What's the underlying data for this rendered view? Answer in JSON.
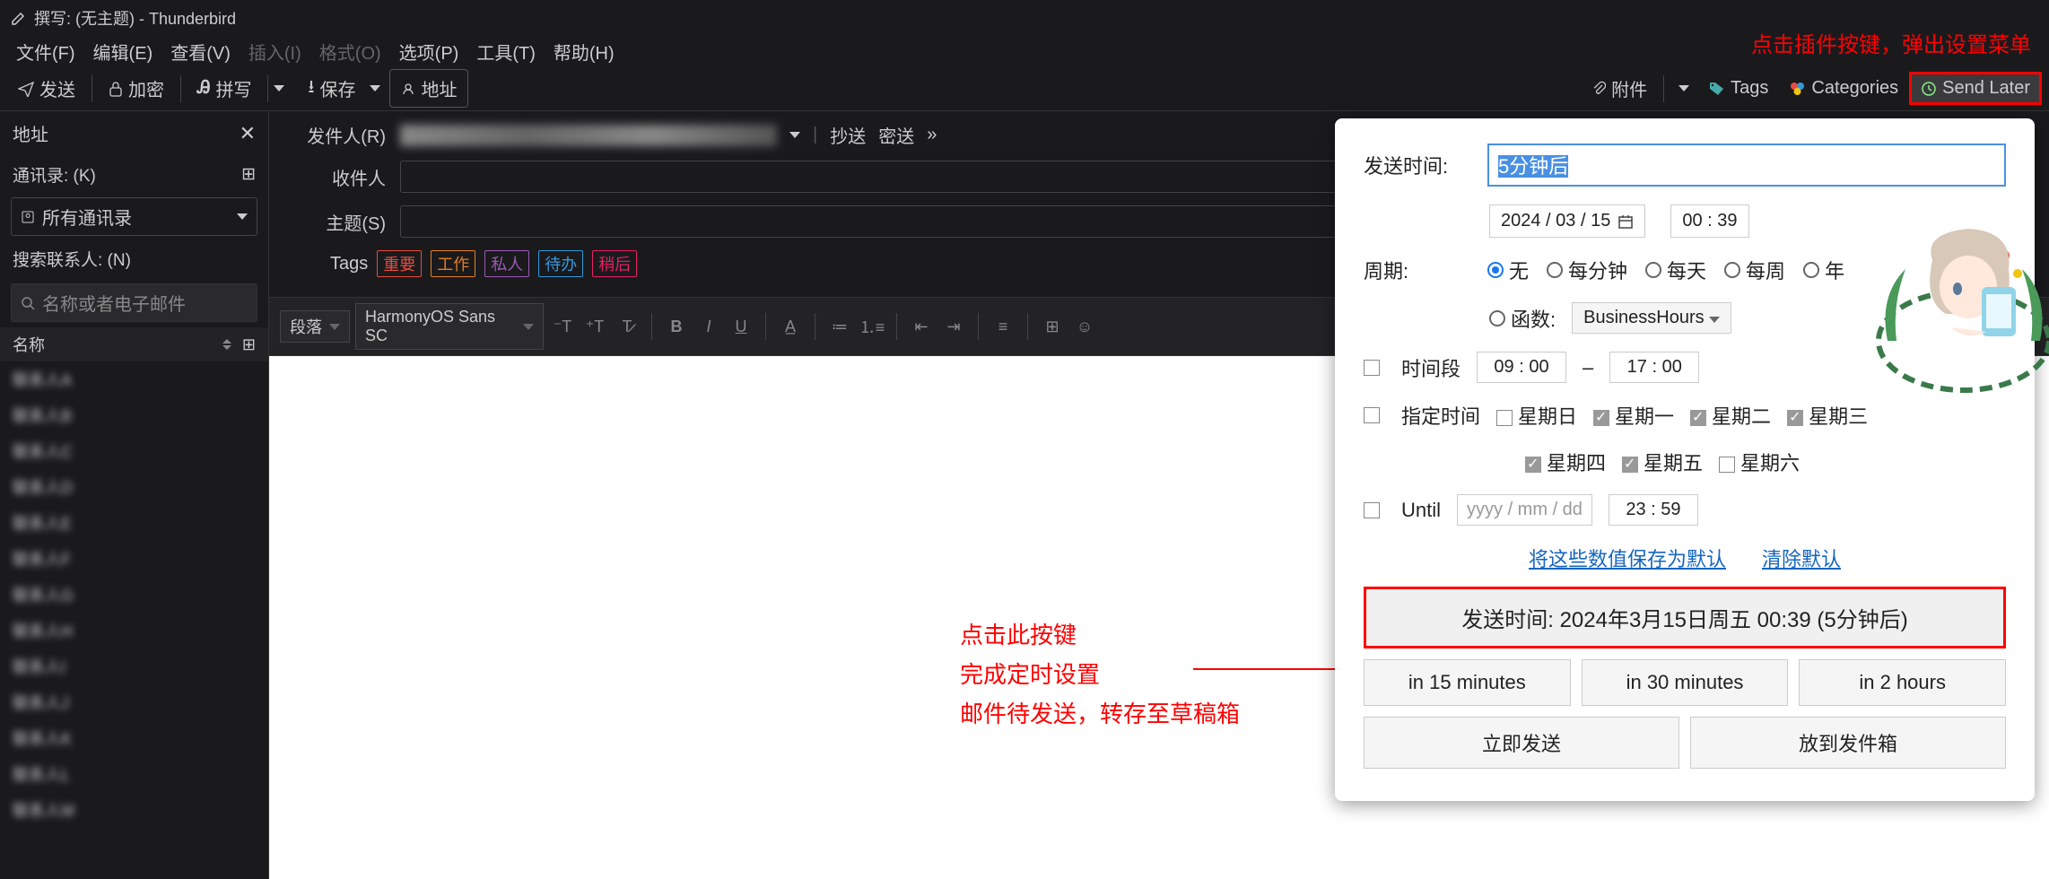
{
  "window": {
    "title": "撰写:  (无主题)  - Thunderbird"
  },
  "menubar": {
    "file": "文件(F)",
    "edit": "编辑(E)",
    "view": "查看(V)",
    "insert": "插入(I)",
    "format": "格式(O)",
    "options": "选项(P)",
    "tools": "工具(T)",
    "help": "帮助(H)"
  },
  "toolbar": {
    "send": "发送",
    "encrypt": "加密",
    "spell": "拼写",
    "save": "保存",
    "address": "地址",
    "attachment": "附件",
    "tags": "Tags",
    "categories": "Categories",
    "send_later": "Send Later"
  },
  "sidebar": {
    "title": "地址",
    "book_label": "通讯录:  (K)",
    "book_selected": "所有通讯录",
    "search_label": "搜索联系人:  (N)",
    "search_placeholder": "名称或者电子邮件",
    "col_name": "名称",
    "contacts": [
      "联系人A",
      "联系人B",
      "联系人C",
      "联系人D",
      "联系人E",
      "联系人F",
      "联系人G",
      "联系人H",
      "联系人I",
      "联系人J",
      "联系人K",
      "联系人L",
      "联系人M"
    ]
  },
  "compose": {
    "from_label": "发件人(R)",
    "to_label": "收件人",
    "subject_label": "主题(S)",
    "cc": "抄送",
    "bcc": "密送",
    "tags_label": "Tags",
    "tags": {
      "important": "重要",
      "work": "工作",
      "personal": "私人",
      "todo": "待办",
      "later": "稍后"
    },
    "format": {
      "paragraph": "段落",
      "font": "HarmonyOS Sans SC"
    }
  },
  "panel": {
    "send_time_label": "发送时间:",
    "send_time_value": "5分钟后",
    "date": "2024 / 03 / 15",
    "time": "00 : 39",
    "cycle_label": "周期:",
    "cycle": {
      "none": "无",
      "per_minute": "每分钟",
      "per_day": "每天",
      "per_week": "每周",
      "per_year": "年",
      "func": "函数:"
    },
    "func_value": "BusinessHours",
    "time_range_label": "时间段",
    "time_range_from": "09 : 00",
    "time_range_sep": "–",
    "time_range_to": "17 : 00",
    "specify_time_label": "指定时间",
    "weekdays": {
      "sun": "星期日",
      "mon": "星期一",
      "tue": "星期二",
      "wed": "星期三",
      "thu": "星期四",
      "fri": "星期五",
      "sat": "星期六"
    },
    "until_label": "Until",
    "until_date": "yyyy / mm / dd",
    "until_time": "23 : 59",
    "save_defaults": "将这些数值保存为默认",
    "clear_defaults": "清除默认",
    "send_at_button": "发送时间:    2024年3月15日周五 00:39 (5分钟后)",
    "in_15": "in 15 minutes",
    "in_30": "in 30 minutes",
    "in_2h": "in 2 hours",
    "send_now": "立即发送",
    "to_outbox": "放到发件箱"
  },
  "annotations": {
    "top": "点击插件按键，弹出设置菜单",
    "mid1": "点击此按键",
    "mid2": "完成定时设置",
    "mid3": "邮件待发送，转存至草稿箱"
  }
}
